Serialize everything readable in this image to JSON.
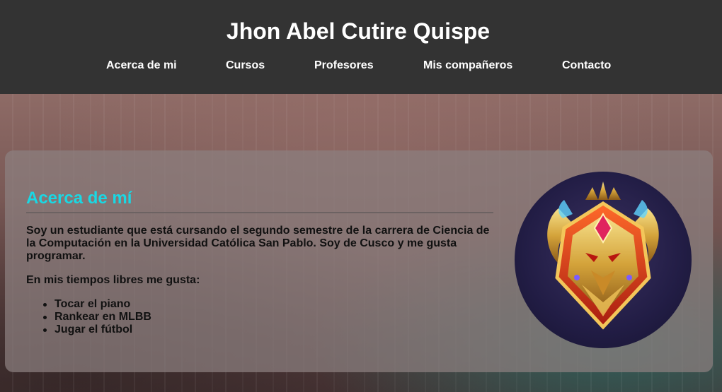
{
  "header": {
    "title": "Jhon Abel Cutire Quispe",
    "nav": [
      {
        "label": "Acerca de mi"
      },
      {
        "label": "Cursos"
      },
      {
        "label": "Profesores"
      },
      {
        "label": "Mis compañeros"
      },
      {
        "label": "Contacto"
      }
    ]
  },
  "about": {
    "heading": "Acerca de mí",
    "intro": "Soy un estudiante que está cursando el segundo semestre de la carrera de Ciencia de la Computación en la Universidad Católica San Pablo. Soy de Cusco y me gusta programar.",
    "hobbies_intro": "En mis tiempos libres me gusta:",
    "hobbies": [
      "Tocar el piano",
      "Rankear en MLBB",
      "Jugar el fútbol"
    ]
  },
  "colors": {
    "header_bg": "#333333",
    "heading_accent": "#19d8e4"
  }
}
